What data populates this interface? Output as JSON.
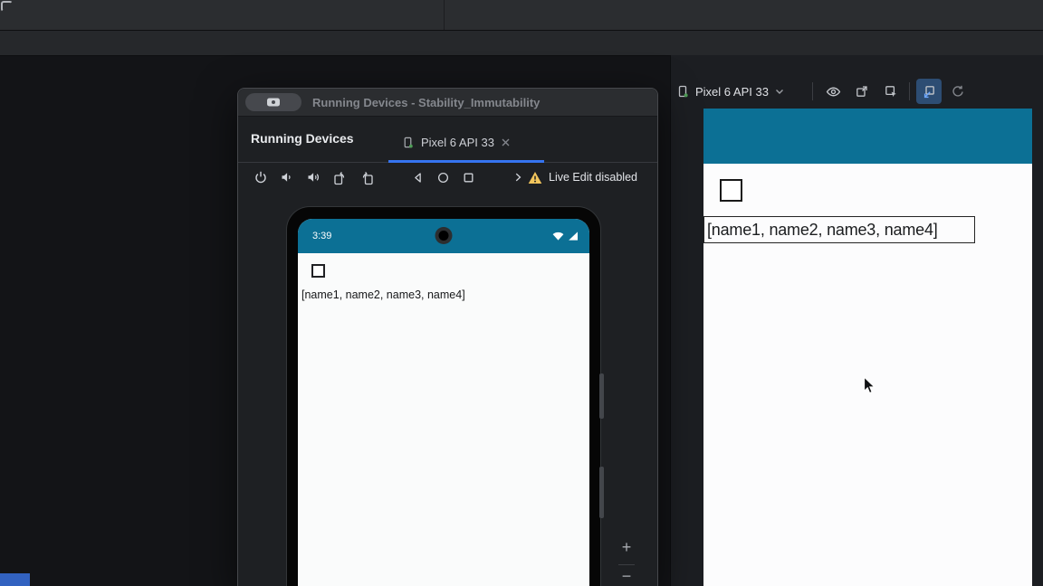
{
  "ide": {
    "right_toolbar": {
      "device_selector_label": "Pixel 6 API 33",
      "icons": [
        "device-icon",
        "chevron-down-icon",
        "visibility-icon",
        "launch-icon",
        "pointer-icon",
        "jump-to-source-icon",
        "refresh-icon"
      ]
    }
  },
  "window": {
    "title": "Running Devices - Stability_Immutability",
    "panel_title": "Running Devices",
    "tab_label": "Pixel 6 API 33",
    "toolbar_icons": [
      "power-icon",
      "volume-down-icon",
      "volume-up-icon",
      "rotate-left-icon",
      "rotate-right-icon",
      "back-icon",
      "home-icon",
      "overview-icon",
      "forward-icon"
    ],
    "live_edit_warning": "Live Edit disabled",
    "zoom_in_label": "+",
    "zoom_out_label": "−"
  },
  "device_screen": {
    "status_time": "3:39",
    "status_icons": [
      "wifi-icon",
      "signal-icon"
    ],
    "list_text": "[name1, name2, name3, name4]"
  },
  "preview": {
    "list_text": "[name1, name2, name3, name4]"
  },
  "colors": {
    "app_bar_teal": "#0c7095",
    "tab_underline_blue": "#3574f0",
    "warning_yellow": "#f2c55c",
    "active_button_bg": "#2d4d73",
    "taskbar_blue": "#3262c0"
  }
}
